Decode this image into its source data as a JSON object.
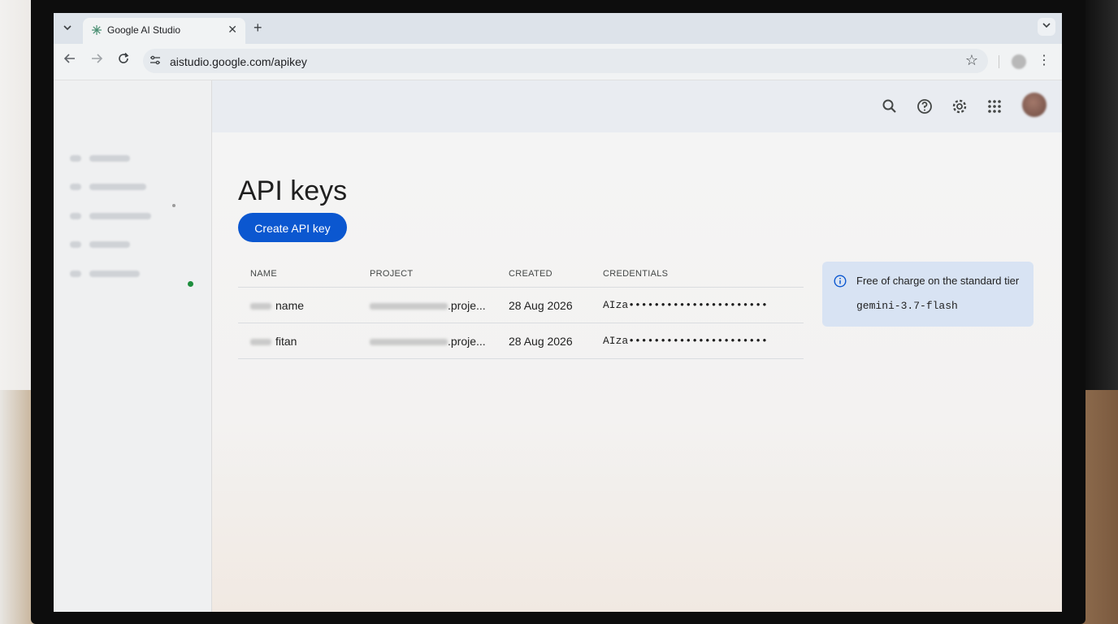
{
  "browser": {
    "tab_title": "Google AI Studio",
    "tab_close": "✕",
    "new_tab": "+",
    "url": "aistudio.google.com/apikey"
  },
  "page": {
    "title": "API keys",
    "create_button": "Create API key"
  },
  "table": {
    "headers": [
      "NAME",
      "PROJECT",
      "CREATED",
      "CREDENTIALS"
    ],
    "rows": [
      {
        "name": "name",
        "project": ".proje...",
        "created": "28 Aug 2026",
        "credentials": "AIza••••••••••••••••••••••"
      },
      {
        "name": "fitan",
        "project": ".proje...",
        "created": "28 Aug 2026",
        "credentials": "AIza••••••••••••••••••••••"
      }
    ]
  },
  "info_card": {
    "text": "Free of charge on the standard tier",
    "model": "gemini-3.7-flash"
  },
  "colors": {
    "primary": "#0b57d0",
    "active_indicator": "#1e8e3e",
    "info_background": "#d8e3f3"
  },
  "icons": {
    "header": [
      "search-icon",
      "help-icon",
      "settings-icon",
      "apps-grid-icon"
    ],
    "info": "info-icon"
  }
}
